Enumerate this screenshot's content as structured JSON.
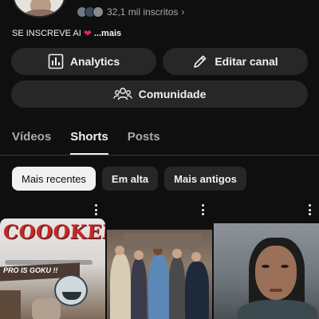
{
  "channel": {
    "subscribers": "32,1 mil inscritos",
    "bio_text": "SE INSCREVE AI",
    "bio_more": "...mais"
  },
  "actions": {
    "analytics_label": "Analytics",
    "edit_label": "Editar canal",
    "community_label": "Comunidade"
  },
  "tabs": [
    {
      "label": "Vídeos",
      "active": false
    },
    {
      "label": "Shorts",
      "active": true
    },
    {
      "label": "Posts",
      "active": false
    }
  ],
  "filters": [
    {
      "label": "Mais recentes",
      "selected": true
    },
    {
      "label": "Em alta",
      "selected": false
    },
    {
      "label": "Mais antigos",
      "selected": false
    }
  ],
  "shorts": [
    {
      "thumb_title": "COOOKED !!",
      "thumb_subtitle": "PRO IS GOKU !!"
    },
    {},
    {}
  ],
  "colors": {
    "background": "#0f0f0f",
    "button_bg": "#272727",
    "chip_selected_bg": "#f1f1f1",
    "heart": "#e0245e",
    "thumb_title": "#c62828"
  },
  "icons": {
    "analytics": "bar-chart-icon",
    "edit": "pencil-icon",
    "community": "people-icon",
    "subs_chevron": "chevron-right-icon",
    "short_menu": "more-vertical-icon"
  }
}
